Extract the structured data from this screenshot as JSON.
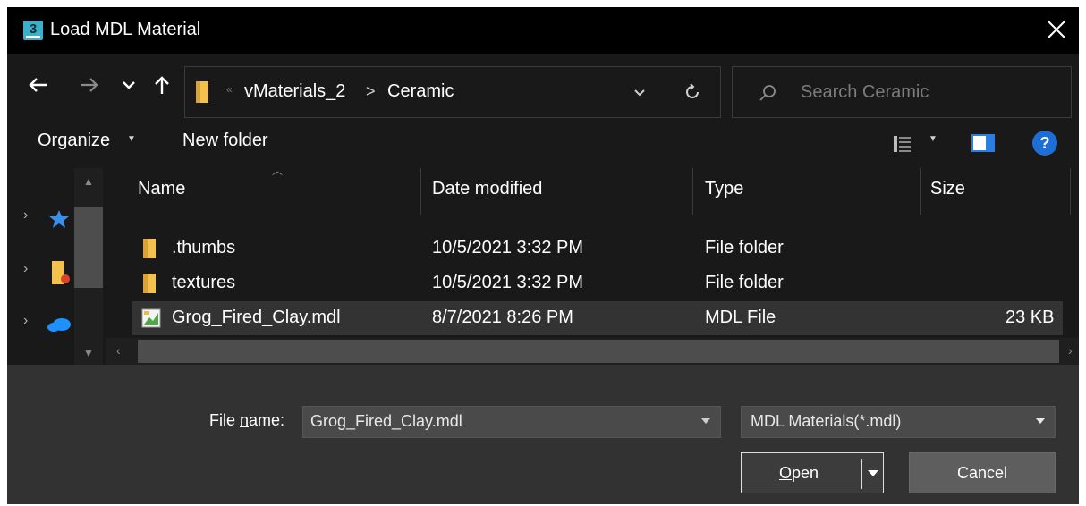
{
  "window": {
    "title": "Load MDL Material",
    "app_icon_glyph": "3"
  },
  "address": {
    "overflow_chevron": "«",
    "crumbs": [
      "vMaterials_2",
      "Ceramic"
    ],
    "separator": ">"
  },
  "search": {
    "placeholder": "Search Ceramic"
  },
  "toolbar": {
    "organize_label": "Organize",
    "new_folder_label": "New folder",
    "help_glyph": "?"
  },
  "columns": {
    "name": "Name",
    "date": "Date modified",
    "type": "Type",
    "size": "Size"
  },
  "files": [
    {
      "name": ".thumbs",
      "date": "10/5/2021 3:32 PM",
      "type": "File folder",
      "size": "",
      "icon": "folder-icon"
    },
    {
      "name": "textures",
      "date": "10/5/2021 3:32 PM",
      "type": "File folder",
      "size": "",
      "icon": "folder-icon"
    },
    {
      "name": "Grog_Fired_Clay.mdl",
      "date": "8/7/2021 8:26 PM",
      "type": "MDL File",
      "size": "23 KB",
      "icon": "mdl-file-icon",
      "selected": true
    }
  ],
  "bottom": {
    "file_name_label_prefix": "File ",
    "file_name_label_accel": "n",
    "file_name_label_suffix": "ame:",
    "file_name_value": "Grog_Fired_Clay.mdl",
    "file_type_value": "MDL Materials(*.mdl)",
    "open_accel": "O",
    "open_rest": "pen",
    "cancel_label": "Cancel"
  },
  "colors": {
    "background": "#191919",
    "title_bar": "#000000",
    "bottom_panel": "#323232",
    "selected_row": "#333333",
    "folder": "#f2c14e",
    "help": "#1d6fd6",
    "quick_access_star": "#3b8eea",
    "onedrive": "#1e90ff"
  }
}
